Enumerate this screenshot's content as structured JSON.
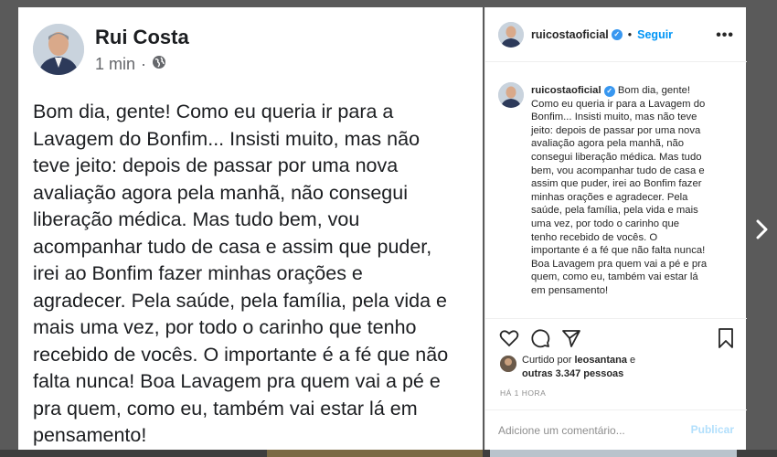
{
  "facebook": {
    "author": "Rui Costa",
    "time": "1 min",
    "post_lines": [
      "Bom dia, gente! Como eu queria ir para a",
      "Lavagem do Bonfim... Insisti muito, mas não",
      "teve jeito: depois de passar por uma nova",
      "avaliação agora pela manhã, não consegui",
      "liberação médica. Mas tudo bem, vou",
      "acompanhar tudo de casa e assim que puder,",
      "irei ao Bonfim fazer minhas orações e",
      "agradecer. Pela saúde, pela família, pela vida e",
      "mais uma vez, por todo o carinho que tenho",
      "recebido de vocês. O importante é a fé que não",
      "falta nunca! Boa Lavagem pra quem vai a pé e",
      "pra quem, como eu, também vai estar lá em",
      "pensamento!"
    ]
  },
  "instagram": {
    "username": "ruicostaoficial",
    "dot": "•",
    "follow_label": "Seguir",
    "more_label": "•••",
    "caption_first": "Bom dia, gente!",
    "caption_lines": [
      "Como eu queria ir para a Lavagem do",
      "Bonfim... Insisti muito, mas não teve",
      "jeito: depois de passar por uma nova",
      "avaliação agora pela manhã, não",
      "consegui liberação médica. Mas tudo",
      "bem, vou acompanhar tudo de casa e",
      "assim que puder, irei ao Bonfim fazer",
      "minhas orações e agradecer. Pela",
      "saúde, pela família, pela vida e mais",
      "uma vez, por todo o carinho que",
      "tenho recebido de vocês. O",
      "importante é a fé que não falta nunca!",
      "Boa Lavagem pra quem vai a pé e pra",
      "quem, como eu, também vai estar lá",
      "em pensamento!"
    ],
    "liked_prefix": "Curtido por",
    "liked_user": "leosantana",
    "liked_and": "e",
    "liked_others": "outras 3.347 pessoas",
    "time_ago": "HÁ 1 HORA",
    "comment_placeholder": "Adicione um comentário...",
    "publish_label": "Publicar"
  },
  "colors": {
    "background": "#5a5a5a",
    "ig_blue": "#0095f6",
    "ig_publish_disabled": "#b2dffc"
  }
}
